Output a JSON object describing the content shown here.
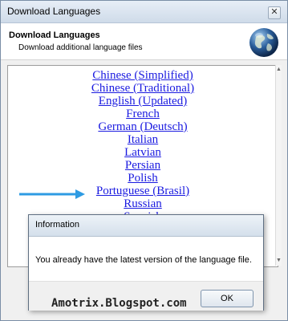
{
  "window": {
    "title": "Download Languages",
    "close_label": "✕"
  },
  "header": {
    "title": "Download Languages",
    "subtitle": "Download additional language files",
    "icon": "globe-icon"
  },
  "languages": [
    "Chinese (Simplified)",
    "Chinese (Traditional)",
    "English (Updated)",
    "French",
    "German (Deutsch)",
    "Italian",
    "Latvian",
    "Persian",
    "Polish",
    "Portuguese (Brasil)",
    "Russian",
    "Spanish"
  ],
  "highlighted_language": "Portuguese (Brasil)",
  "arrow_color": "#2e9be3",
  "dialog": {
    "title": "Information",
    "message": "You already have the latest version of the language file.",
    "ok_label": "OK"
  },
  "watermark": "Amotrix.Blogspot.com"
}
